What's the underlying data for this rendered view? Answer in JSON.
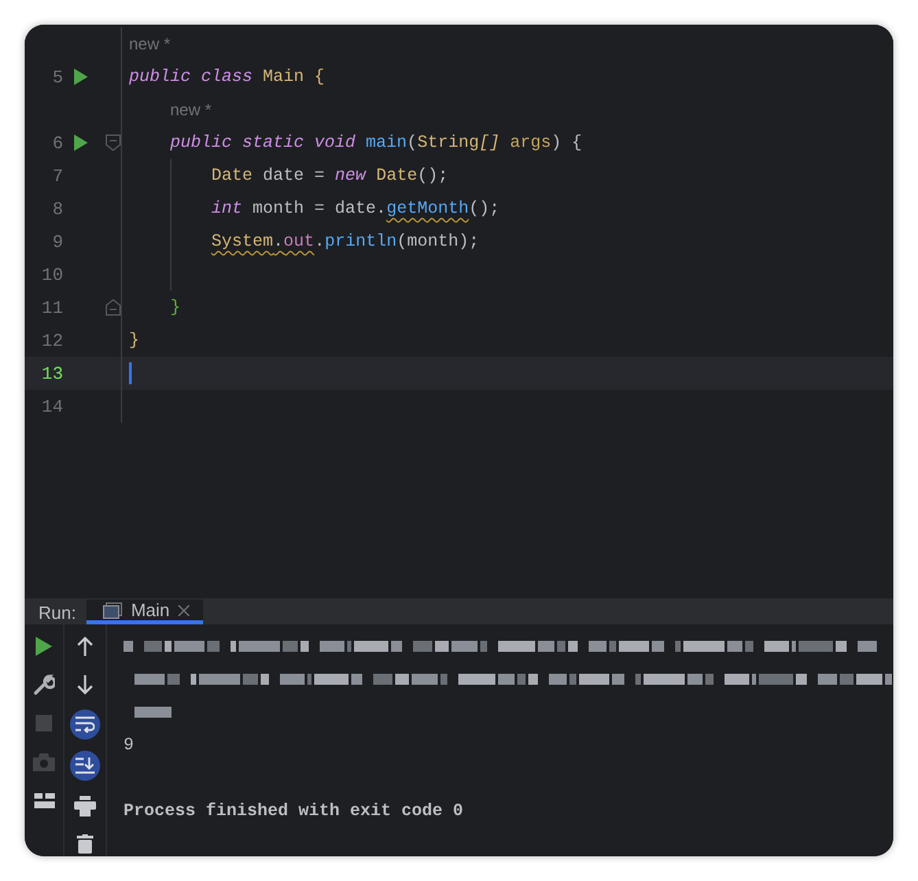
{
  "editor": {
    "rows": [
      {
        "kind": "lens",
        "indented": false,
        "text": "new *"
      },
      {
        "kind": "code",
        "number": "5",
        "runnable": true,
        "fold_start": false,
        "fold_end": false,
        "current": false,
        "guide": false,
        "tokens": [
          {
            "text": "public class ",
            "kind": "keyword"
          },
          {
            "text": "Main ",
            "kind": "type"
          },
          {
            "text": "{",
            "kind": "brace-outer"
          }
        ]
      },
      {
        "kind": "lens",
        "indented": true,
        "text": "new *"
      },
      {
        "kind": "code",
        "number": "6",
        "runnable": true,
        "fold_start": true,
        "fold_end": false,
        "current": false,
        "guide": false,
        "tokens": [
          {
            "text": "    public static void ",
            "kind": "keyword"
          },
          {
            "text": "main",
            "kind": "method"
          },
          {
            "text": "(",
            "kind": "plain"
          },
          {
            "text": "String",
            "kind": "type"
          },
          {
            "text": "[]",
            "kind": "array"
          },
          {
            "text": " args",
            "kind": "param"
          },
          {
            "text": ") {",
            "kind": "plain"
          }
        ]
      },
      {
        "kind": "code",
        "number": "7",
        "runnable": false,
        "fold_start": false,
        "fold_end": false,
        "current": false,
        "guide": true,
        "tokens": [
          {
            "text": "Date",
            "kind": "type"
          },
          {
            "text": " date = ",
            "kind": "plain"
          },
          {
            "text": "new ",
            "kind": "keyword"
          },
          {
            "text": "Date",
            "kind": "type"
          },
          {
            "text": "();",
            "kind": "plain"
          }
        ]
      },
      {
        "kind": "code",
        "number": "8",
        "runnable": false,
        "fold_start": false,
        "fold_end": false,
        "current": false,
        "guide": true,
        "tokens": [
          {
            "text": "int",
            "kind": "keyword"
          },
          {
            "text": " month = date.",
            "kind": "plain"
          },
          {
            "text": "getMonth",
            "kind": "method",
            "warning": true
          },
          {
            "text": "();",
            "kind": "plain"
          }
        ]
      },
      {
        "kind": "code",
        "number": "9",
        "runnable": false,
        "fold_start": false,
        "fold_end": false,
        "current": false,
        "guide": true,
        "tokens": [
          {
            "text": "System",
            "kind": "type",
            "warning": true
          },
          {
            "text": ".",
            "kind": "plain",
            "warning": true
          },
          {
            "text": "out",
            "kind": "field",
            "warning": true
          },
          {
            "text": ".",
            "kind": "plain"
          },
          {
            "text": "println",
            "kind": "method"
          },
          {
            "text": "(month);",
            "kind": "plain"
          }
        ]
      },
      {
        "kind": "code",
        "number": "10",
        "runnable": false,
        "fold_start": false,
        "fold_end": false,
        "current": false,
        "guide": true,
        "tokens": []
      },
      {
        "kind": "code",
        "number": "11",
        "runnable": false,
        "fold_start": false,
        "fold_end": true,
        "current": false,
        "guide": false,
        "tokens": [
          {
            "text": "    }",
            "kind": "brace-inner"
          }
        ]
      },
      {
        "kind": "code",
        "number": "12",
        "runnable": false,
        "fold_start": false,
        "fold_end": false,
        "current": false,
        "guide": false,
        "tokens": [
          {
            "text": "}",
            "kind": "brace-outer"
          }
        ]
      },
      {
        "kind": "code",
        "number": "13",
        "runnable": false,
        "fold_start": false,
        "fold_end": false,
        "current": true,
        "guide": false,
        "tokens": []
      },
      {
        "kind": "code",
        "number": "14",
        "runnable": false,
        "fold_start": false,
        "fold_end": false,
        "current": false,
        "guide": false,
        "tokens": []
      }
    ]
  },
  "run_panel": {
    "label": "Run:",
    "tabs": [
      {
        "label": "Main",
        "selected": true
      }
    ],
    "tools_left": [
      {
        "kind": "rerun",
        "disabled": false
      },
      {
        "kind": "settings",
        "disabled": false
      },
      {
        "kind": "stop",
        "disabled": true
      },
      {
        "kind": "camera",
        "disabled": true
      },
      {
        "kind": "layout",
        "disabled": false
      }
    ],
    "tools_right": [
      {
        "kind": "up",
        "on": false
      },
      {
        "kind": "down",
        "on": false
      },
      {
        "kind": "wrap",
        "on": true
      },
      {
        "kind": "scroll-end",
        "on": true
      },
      {
        "kind": "print",
        "on": false
      },
      {
        "kind": "trash",
        "on": false
      }
    ],
    "console": [
      {
        "kind": "redacted"
      },
      {
        "kind": "redacted"
      },
      {
        "kind": "redacted"
      },
      {
        "kind": "output",
        "text": "9"
      },
      {
        "kind": "blank"
      },
      {
        "kind": "status",
        "text": "Process finished with exit code 0"
      }
    ]
  }
}
